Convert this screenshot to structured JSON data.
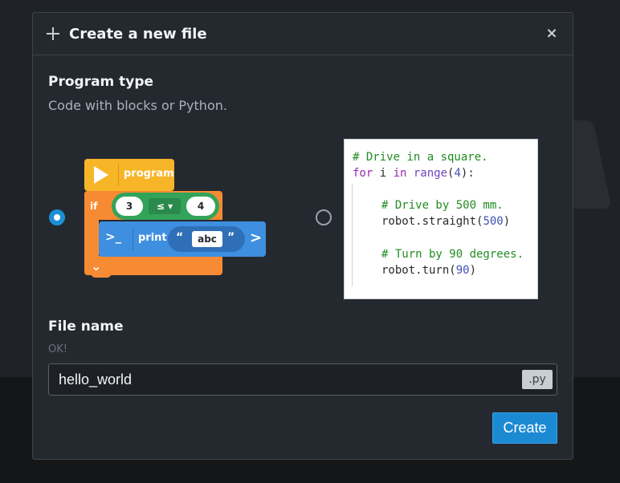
{
  "dialog": {
    "title": "Create a new file",
    "close_icon": "×"
  },
  "program_type": {
    "heading": "Program type",
    "subheading": "Code with blocks or Python.",
    "selected": "blocks"
  },
  "blocks_example": {
    "start_label": "program",
    "if_label": "if",
    "left_operand": "3",
    "operator": "≤ ▾",
    "right_operand": "4",
    "print_label": "print",
    "string_value": "abc",
    "open_quote": "“",
    "close_quote": "”"
  },
  "python_example": {
    "line1": "# Drive in a square.",
    "line2_kw": "for",
    "line2_var": " i ",
    "line2_in": "in",
    "line2_fn": " range",
    "line2_paren_open": "(",
    "line2_num": "4",
    "line2_rest": "):",
    "line3": "# Drive by 500 mm.",
    "line4_call": "robot.straight(",
    "line4_num": "500",
    "line4_end": ")",
    "line5": "# Turn by 90 degrees.",
    "line6_call": "robot.turn(",
    "line6_num": "90",
    "line6_end": ")"
  },
  "file_name": {
    "heading": "File name",
    "status": "OK!",
    "value": "hello_world",
    "extension": ".py"
  },
  "create_button": "Create",
  "colors": {
    "accent": "#1b8ad3",
    "program_block": "#f7b528",
    "if_block": "#f68b33",
    "compare_block": "#34a35a",
    "print_block": "#3f8fe0"
  }
}
